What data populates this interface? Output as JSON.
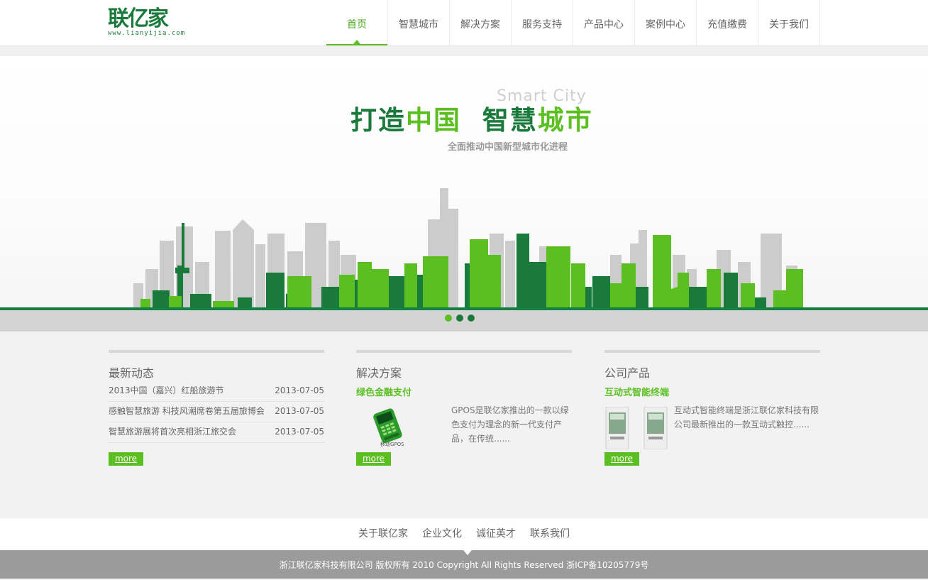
{
  "logo": {
    "text": "联亿家",
    "url": "www.lianyijia.com"
  },
  "nav": [
    {
      "label": "首页",
      "active": true
    },
    {
      "label": "智慧城市"
    },
    {
      "label": "解决方案"
    },
    {
      "label": "服务支持"
    },
    {
      "label": "产品中心"
    },
    {
      "label": "案例中心"
    },
    {
      "label": "充值缴费"
    },
    {
      "label": "关于我们"
    }
  ],
  "banner": {
    "smart_city": "Smart City",
    "slogan_a": "打造",
    "slogan_b": "中国",
    "slogan_c": "智慧",
    "slogan_d": "城市",
    "subtitle": "全面推动中国新型城市化进程",
    "slide_count": 3,
    "active_slide": 1
  },
  "news": {
    "title": "最新动态",
    "items": [
      {
        "title": "2013中国（嘉兴）红船旅游节",
        "date": "2013-07-05"
      },
      {
        "title": "感触智慧旅游 科技风潮席卷第五届旅博会",
        "date": "2013-07-05"
      },
      {
        "title": "智慧旅游展将首次亮相浙江旅交会",
        "date": "2013-07-05"
      }
    ],
    "more": "more"
  },
  "solution": {
    "title": "解决方案",
    "subtitle": "绿色金融支付",
    "image_caption": "移动GPOS",
    "description": "GPOS是联亿家推出的一款以绿色支付为理念的新一代支付产品，在传统......",
    "more": "more"
  },
  "product": {
    "title": "公司产品",
    "subtitle": "互动式智能终端",
    "description": "互动式智能终端是浙江联亿家科技有限公司最新推出的一款互动式触控......",
    "more": "more"
  },
  "footer": {
    "links": [
      "关于联亿家",
      "企业文化",
      "诚征英才",
      "联系我们"
    ],
    "copyright": "浙江联亿家科技有限公司 版权所有 2010 Copyright All Rights Reserved 浙ICP备10205779号"
  },
  "colors": {
    "dark_green": "#1a7a3c",
    "light_green": "#5bbf21",
    "gray_building": "#cccccc"
  }
}
